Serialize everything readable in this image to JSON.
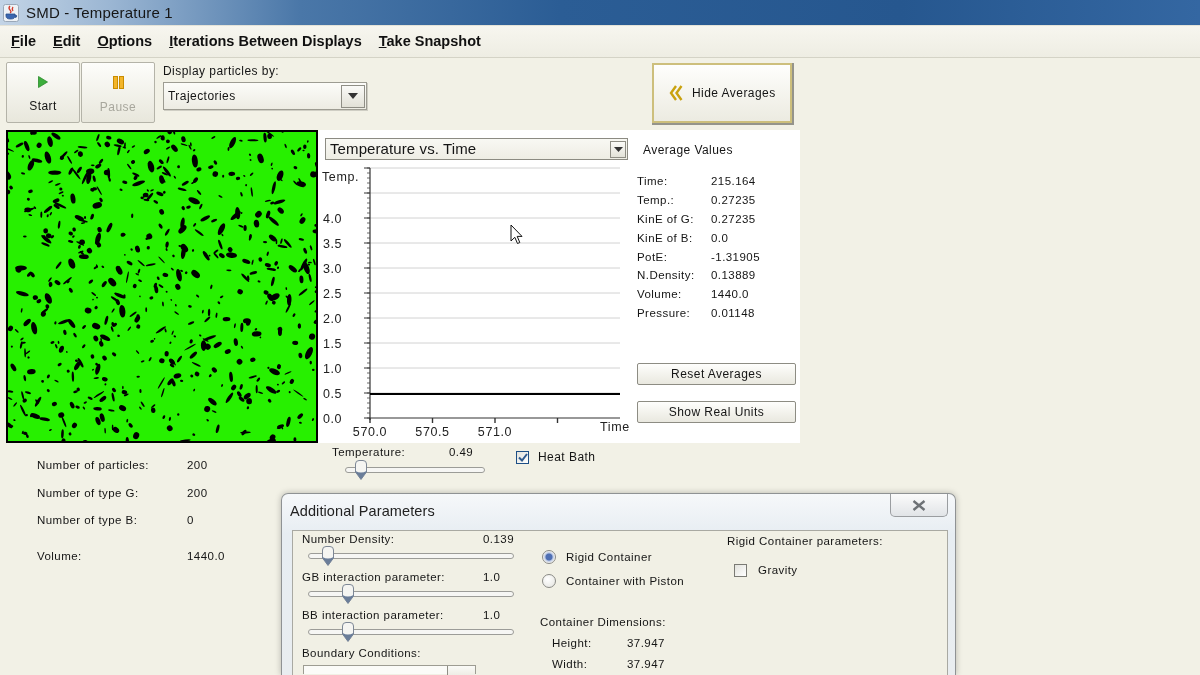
{
  "window": {
    "title": "SMD - Temperature 1"
  },
  "menu": [
    "File",
    "Edit",
    "Options",
    "Iterations Between Displays",
    "Take Snapshot"
  ],
  "toolbar": {
    "buttons": [
      {
        "label": "Start",
        "kind": "play",
        "disabled": false
      },
      {
        "label": "Pause",
        "kind": "pause",
        "disabled": true
      }
    ],
    "display_by": {
      "label": "Display particles by:",
      "value": "Trajectories"
    },
    "hide_averages": {
      "label": "Hide Averages"
    }
  },
  "chart_panel": {
    "selector": "Temperature vs. Time",
    "chart_data": {
      "type": "line",
      "xlabel": "Time",
      "ylabel": "Temp.",
      "x": [
        570.0,
        572.0
      ],
      "series": [
        {
          "color": "#000000",
          "values": [
            0.48,
            0.48
          ]
        }
      ],
      "xlim": [
        570,
        572
      ],
      "ylim": [
        0,
        5
      ],
      "xticks": [
        {
          "value": 570,
          "label": "570.0"
        },
        {
          "value": 570.5,
          "label": "570.5"
        },
        {
          "value": 571,
          "label": "571.0"
        }
      ],
      "yticks": [
        {
          "value": 0,
          "label": "0.0"
        },
        {
          "value": 0.5,
          "label": "0.5"
        },
        {
          "value": 1,
          "label": "1.0"
        },
        {
          "value": 1.5,
          "label": "1.5"
        },
        {
          "value": 2,
          "label": "2.0"
        },
        {
          "value": 2.5,
          "label": "2.5"
        },
        {
          "value": 3,
          "label": "3.0"
        },
        {
          "value": 3.5,
          "label": "3.5"
        },
        {
          "value": 4,
          "label": "4.0"
        }
      ],
      "grid": true
    }
  },
  "averages": {
    "title": "Average Values",
    "rows": [
      {
        "label": "Time:",
        "value": "215.164"
      },
      {
        "label": "Temp.:",
        "value": "0.27235"
      },
      {
        "label": "KinE of G:",
        "value": "0.27235"
      },
      {
        "label": "KinE of B:",
        "value": "0.0"
      },
      {
        "label": "PotE:",
        "value": "-1.31905"
      },
      {
        "label": "N.Density:",
        "value": "0.13889"
      },
      {
        "label": "Volume:",
        "value": "1440.0"
      },
      {
        "label": "Pressure:",
        "value": "0.01148"
      }
    ],
    "buttons": [
      "Reset Averages",
      "Show Real Units"
    ]
  },
  "particle_counts": [
    {
      "label": "Number of particles:",
      "value": "200"
    },
    {
      "label": "Number of type G:",
      "value": "200"
    },
    {
      "label": "Number of type B:",
      "value": "0"
    }
  ],
  "volume": {
    "label": "Volume:",
    "value": "1440.0"
  },
  "temperature": {
    "label": "Temperature:",
    "value": "0.49",
    "level": 0.07
  },
  "heat_bath": {
    "label": "Heat Bath",
    "checked": true
  },
  "dialog": {
    "title": "Additional Parameters",
    "sliders": [
      {
        "label": "Number Density:",
        "value": "0.139",
        "level": 0.07
      },
      {
        "label": "GB interaction parameter:",
        "value": "1.0",
        "level": 0.17
      },
      {
        "label": "BB interaction parameter:",
        "value": "1.0",
        "level": 0.17
      }
    ],
    "boundary": {
      "label": "Boundary Conditions:"
    },
    "container_types": [
      {
        "label": "Rigid Container",
        "selected": true
      },
      {
        "label": "Container with Piston",
        "selected": false
      }
    ],
    "dimensions": {
      "title": "Container Dimensions:",
      "rows": [
        {
          "label": "Height:",
          "value": "37.947"
        },
        {
          "label": "Width:",
          "value": "37.947"
        }
      ]
    },
    "rigid_params": {
      "title": "Rigid Container parameters:",
      "options": [
        {
          "label": "Gravity",
          "checked": false
        }
      ]
    }
  }
}
